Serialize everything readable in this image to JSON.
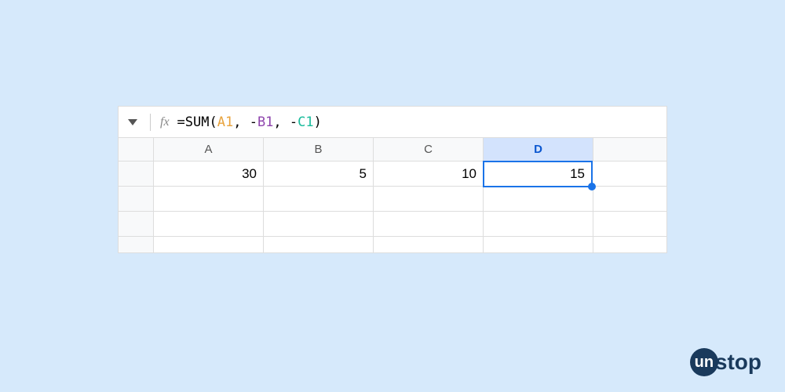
{
  "formula_bar": {
    "fx_label": "fx",
    "formula_prefix": "=SUM(",
    "ref_a1": "A1",
    "comma1": ", -",
    "ref_b1": "B1",
    "comma2": ", -",
    "ref_c1": "C1",
    "formula_suffix": ")"
  },
  "columns": {
    "a": "A",
    "b": "B",
    "c": "C",
    "d": "D"
  },
  "cells": {
    "a1": "30",
    "b1": "5",
    "c1": "10",
    "d1": "15"
  },
  "selected": "D1",
  "logo": {
    "circle": "un",
    "text": "stop"
  },
  "chart_data": {
    "type": "table",
    "headers": [
      "A",
      "B",
      "C",
      "D"
    ],
    "rows": [
      [
        30,
        5,
        10,
        15
      ]
    ],
    "formula": "=SUM(A1, -B1, -C1)",
    "selected_cell": "D1"
  }
}
